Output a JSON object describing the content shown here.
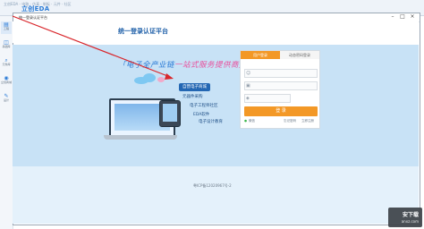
{
  "app": {
    "title_small": "立创EDA - 电路 · 仿真 · 制板 · 元件 · 社区",
    "brand": "立创EDA"
  },
  "rail": {
    "items": [
      {
        "label": "工程",
        "icon": "folder-icon"
      },
      {
        "label": "基础库",
        "icon": "library-icon"
      },
      {
        "label": "元件库",
        "icon": "search-icon"
      },
      {
        "label": "立创商城",
        "icon": "cart-icon"
      },
      {
        "label": "设计",
        "icon": "pen-icon"
      }
    ]
  },
  "dialog": {
    "title": "统一登录认证平台",
    "controls": {
      "minimize": "–",
      "maximize": "□",
      "close": "×"
    }
  },
  "page": {
    "heading": "统一登录认证平台",
    "slogan_left": "「电子全产业链",
    "slogan_right": "一站式服务提供商」",
    "flow": [
      "自营电子商城",
      "元器件采购",
      "电子工程师社区",
      "EDA软件",
      "电子设计教育"
    ],
    "icp": "粤ICP备12020967号-2"
  },
  "login": {
    "tab_active": "用户登录",
    "tab_inactive": "动态密码登录",
    "username_placeholder": "",
    "password_placeholder": "",
    "captcha_placeholder": "",
    "button": "登 录",
    "wechat_label": "微信",
    "forgot": "忘记密码",
    "register": "立即注册"
  },
  "watermark": {
    "top": "安下载",
    "bottom": "anxz.com"
  },
  "colors": {
    "accent_orange": "#f39826",
    "brand_blue": "#2b7bd6",
    "band_blue": "#c8e2f6",
    "annotation_red": "#d9262b"
  }
}
